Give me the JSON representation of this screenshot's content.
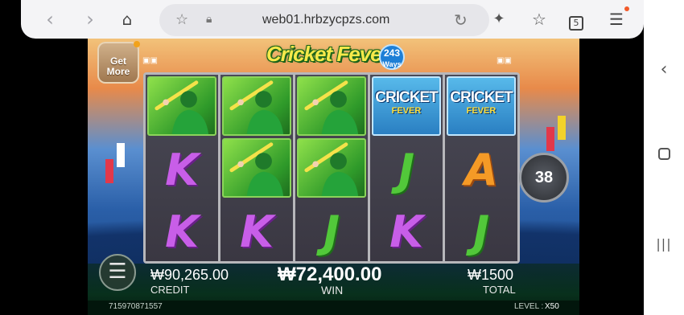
{
  "browser": {
    "back_icon": "chevron-left-icon",
    "forward_icon": "chevron-right-icon",
    "home_icon": "home-icon",
    "bookmark_icon": "star-icon",
    "lock_icon": "lock-icon",
    "url": "web01.hrbzycpzs.com",
    "reload_icon": "reload-icon",
    "tab_count": "5"
  },
  "game": {
    "logo_text": "Cricket Fever",
    "logo_badge_value": "243",
    "logo_badge_unit": "Ways",
    "get_more_line1": "Get",
    "get_more_line2": "More",
    "spin_count": "38",
    "reels": [
      [
        "player",
        "K",
        "K"
      ],
      [
        "player",
        "player",
        "K"
      ],
      [
        "player",
        "player",
        "J"
      ],
      [
        "scatter",
        "J",
        "K"
      ],
      [
        "scatter",
        "A",
        "J"
      ]
    ],
    "scatter_title": "CRICKET",
    "scatter_sub": "FEVER",
    "credit_value": "₩90,265.00",
    "credit_label": "CREDIT",
    "win_value": "₩72,400.00",
    "win_label": "WIN",
    "total_value": "₩1500",
    "total_label": "TOTAL",
    "session_id": "715970871557",
    "level_label": "LEVEL :",
    "level_value": "X50"
  },
  "colors": {
    "player_bg": "#2f9a2a",
    "scatter_bg": "#2a7fc2",
    "letter_k": "#c85ee8",
    "letter_j": "#52c83a",
    "letter_a": "#f59a26"
  }
}
